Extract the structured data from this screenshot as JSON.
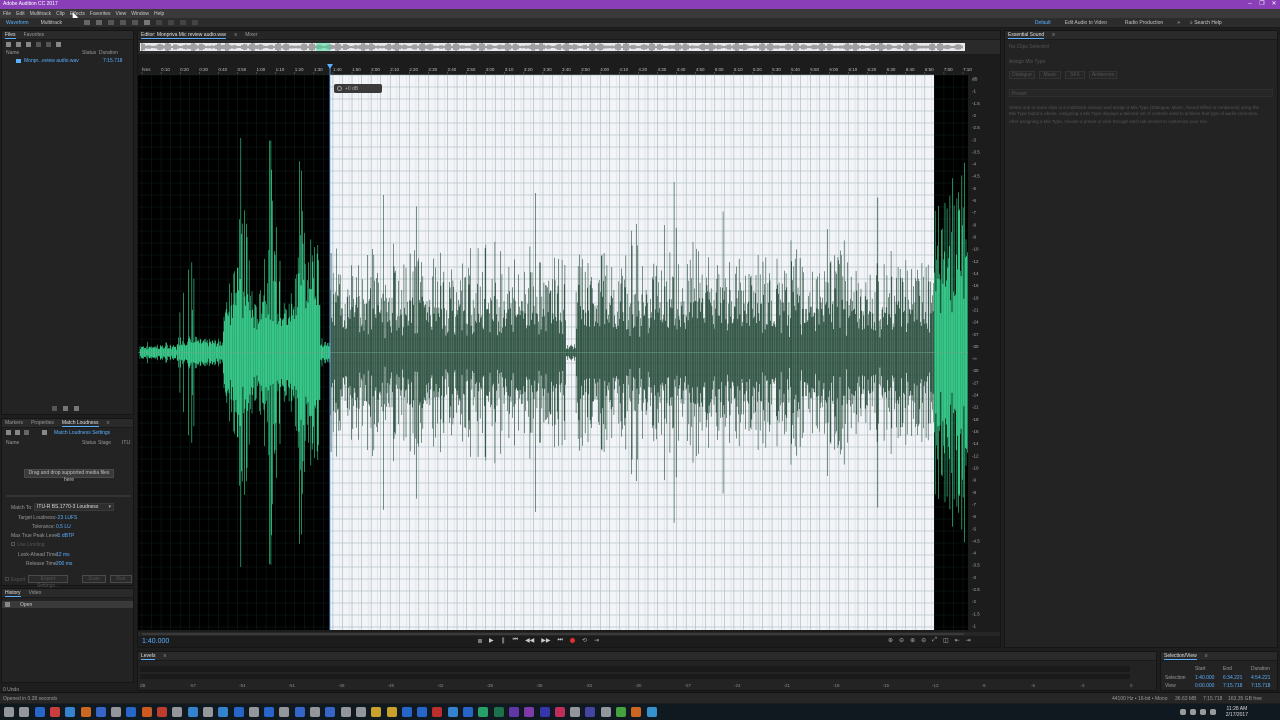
{
  "app": {
    "title": "Adobe Audition CC 2017",
    "window_controls": [
      "–",
      "❐",
      "✕"
    ]
  },
  "menu": [
    "File",
    "Edit",
    "Multitrack",
    "Clip",
    "Effects",
    "Favorites",
    "View",
    "Window",
    "Help"
  ],
  "toolbar": {
    "waveform_label": "Waveform",
    "multitrack_label": "Multitrack",
    "workspaces": [
      "Default",
      "Edit Audio to Video",
      "Radio Production"
    ],
    "search_label": "Search Help"
  },
  "files_panel": {
    "tabs": [
      "Files",
      "Favorites"
    ],
    "columns": [
      "Name",
      "Status",
      "Duration"
    ],
    "items": [
      {
        "name": "Monpr...eview audio.wav",
        "duration": "7:15.718"
      }
    ]
  },
  "match_panel": {
    "tabs": [
      "Markers",
      "Properties",
      "Match Loudness"
    ],
    "settings_label": "Match Loudness Settings",
    "columns": [
      "Name",
      "Status",
      "Stage",
      "ITU"
    ],
    "drop_hint": "Drag and drop supported media files here",
    "fields": [
      {
        "label": "Match To:",
        "value": "ITU-R BS.1770-3 Loudness"
      },
      {
        "label": "Target Loudness:",
        "value": "-23 LUFS"
      },
      {
        "label": "Tolerance:",
        "value": "0.5 LU"
      },
      {
        "label": "Max True Peak Level:",
        "value": "-1 dBTP"
      },
      {
        "label": "Look-Ahead Time:",
        "value": "12 ms"
      },
      {
        "label": "Release Time:",
        "value": "200 ms"
      }
    ],
    "limiting_label": "Use Limiting",
    "export_label": "Export",
    "export_settings_label": "Export Settings...",
    "scan_label": "Scan",
    "run_label": "Run"
  },
  "history_panel": {
    "tabs": [
      "History",
      "Video"
    ],
    "items": [
      "Open"
    ]
  },
  "editor": {
    "tabs": [
      "Editor: Monpriva Mic review audio.wav",
      "Mixer"
    ],
    "hud_label": "+0 dB",
    "timecode": "1:40.000",
    "ruler_ticks": [
      "hms",
      "0:10",
      "0:20",
      "0:30",
      "0:40",
      "0:50",
      "1:00",
      "1:10",
      "1:20",
      "1:30",
      "1:40",
      "1:50",
      "2:00",
      "2:10",
      "2:20",
      "2:30",
      "2:40",
      "2:50",
      "3:00",
      "3:10",
      "3:20",
      "3:30",
      "3:40",
      "3:50",
      "4:00",
      "4:10",
      "4:20",
      "4:30",
      "4:40",
      "4:50",
      "5:00",
      "5:10",
      "5:20",
      "5:30",
      "5:40",
      "5:50",
      "6:00",
      "6:10",
      "6:20",
      "6:30",
      "6:40",
      "6:50",
      "7:00",
      "7:10"
    ],
    "db_ticks": [
      "dB",
      "-1",
      "-1.5",
      "-2",
      "-2.5",
      "-3",
      "-3.5",
      "-4",
      "-4.5",
      "-5",
      "-6",
      "-7",
      "-8",
      "-9",
      "-10",
      "-12",
      "-14",
      "-16",
      "-18",
      "-21",
      "-24",
      "-27",
      "-30",
      "-∞",
      "-30",
      "-27",
      "-24",
      "-21",
      "-18",
      "-16",
      "-14",
      "-12",
      "-10",
      "-9",
      "-8",
      "-7",
      "-6",
      "-5",
      "-4.5",
      "-4",
      "-3.5",
      "-3",
      "-2.5",
      "-2",
      "-1.5",
      "-1"
    ]
  },
  "essential_sound": {
    "title": "Essential Sound",
    "no_clips": "No Clips Selected",
    "assign_label": "Assign Mix Type",
    "types": [
      "Dialogue",
      "Music",
      "SFX",
      "Ambience"
    ],
    "preset_label": "Preset:",
    "help_text": "Select one or more clips in a multitrack session and assign a Mix Type (Dialogue, Music, Sound Effect or Ambience) using the Mix Type buttons above. Assigning a Mix Type displays a tailored set of controls used to achieve that type of audio correction.",
    "help_text2": "After assigning a Mix Type, choose a preset or click through each tab section to customize your mix."
  },
  "levels": {
    "title": "Levels",
    "scale": [
      "dB",
      "-57",
      "-54",
      "-51",
      "-48",
      "-45",
      "-42",
      "-39",
      "-36",
      "-33",
      "-30",
      "-27",
      "-24",
      "-21",
      "-18",
      "-15",
      "-12",
      "-9",
      "-6",
      "-3",
      "0"
    ]
  },
  "selection_view": {
    "title": "Selection/View",
    "headers": [
      "Start",
      "End",
      "Duration"
    ],
    "rows": [
      {
        "label": "Selection",
        "start": "1:40.000",
        "end": "6:34.221",
        "duration": "4:54.221"
      },
      {
        "label": "View",
        "start": "0:00.000",
        "end": "7:15.718",
        "duration": "7:15.718"
      }
    ]
  },
  "status": {
    "left": "Opened in 0.28 seconds",
    "undo": "0 Undo",
    "format": "44100 Hz • 16-bit • Mono",
    "size": "36.63 MB",
    "duration": "7:15.718",
    "free": "163.35 GB free"
  },
  "clock": {
    "time": "11:28 AM",
    "date": "2/17/2017"
  },
  "colors": {
    "waveform": "#3ddc97",
    "selected_bg": "#f2f4f8",
    "accent": "#5ab0ff",
    "titlebar": "#8a3fb8"
  }
}
